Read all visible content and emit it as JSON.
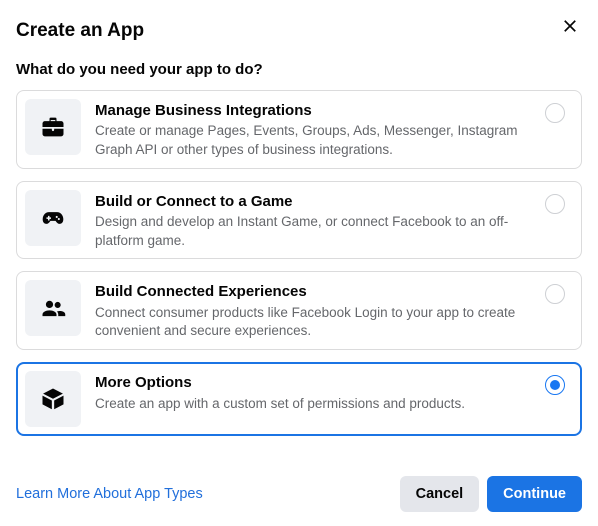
{
  "header": {
    "title": "Create an App"
  },
  "subtitle": "What do you need your app to do?",
  "options": [
    {
      "title": "Manage Business Integrations",
      "desc": "Create or manage Pages, Events, Groups, Ads, Messenger, Instagram Graph API or other types of business integrations.",
      "selected": false
    },
    {
      "title": "Build or Connect to a Game",
      "desc": "Design and develop an Instant Game, or connect Facebook to an off-platform game.",
      "selected": false
    },
    {
      "title": "Build Connected Experiences",
      "desc": "Connect consumer products like Facebook Login to your app to create convenient and secure experiences.",
      "selected": false
    },
    {
      "title": "More Options",
      "desc": "Create an app with a custom set of permissions and products.",
      "selected": true
    }
  ],
  "footer": {
    "learn_more": "Learn More About App Types",
    "cancel": "Cancel",
    "continue": "Continue"
  }
}
